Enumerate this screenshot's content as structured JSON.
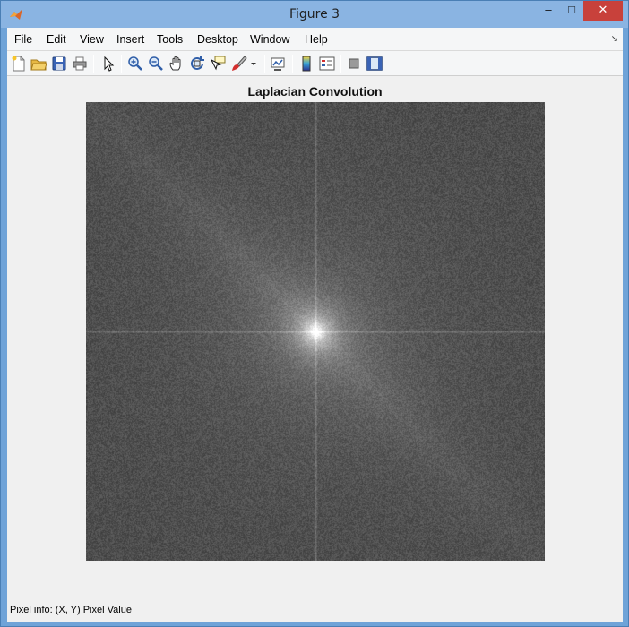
{
  "window": {
    "title": "Figure 3",
    "minimize_glyph": "–",
    "maximize_glyph": "□",
    "close_glyph": "✕"
  },
  "menu": {
    "items": [
      {
        "label": "File",
        "key": "file"
      },
      {
        "label": "Edit",
        "key": "edit"
      },
      {
        "label": "View",
        "key": "view"
      },
      {
        "label": "Insert",
        "key": "insert"
      },
      {
        "label": "Tools",
        "key": "tools"
      },
      {
        "label": "Desktop",
        "key": "desktop"
      },
      {
        "label": "Window",
        "key": "window"
      },
      {
        "label": "Help",
        "key": "help"
      }
    ],
    "dock_arrow": "↘"
  },
  "toolbar": {
    "buttons": [
      {
        "icon": "new-figure-icon"
      },
      {
        "icon": "open-file-icon"
      },
      {
        "icon": "save-icon"
      },
      {
        "icon": "print-icon"
      },
      {
        "icon": "edit-plot-arrow-icon"
      },
      {
        "icon": "zoom-in-icon"
      },
      {
        "icon": "zoom-out-icon"
      },
      {
        "icon": "pan-hand-icon"
      },
      {
        "icon": "rotate-3d-icon"
      },
      {
        "icon": "data-cursor-icon"
      },
      {
        "icon": "brush-icon"
      },
      {
        "icon": "brush-dropdown-icon"
      },
      {
        "icon": "link-plot-icon"
      },
      {
        "icon": "insert-colorbar-icon"
      },
      {
        "icon": "insert-legend-icon"
      },
      {
        "icon": "hide-plot-tools-icon"
      },
      {
        "icon": "show-plot-tools-icon"
      }
    ]
  },
  "figure": {
    "title": "Laplacian Convolution",
    "image_description_colors": {
      "background_gray": "#4a4a4a",
      "center_bright": "#e0e0e0"
    }
  },
  "status": {
    "pixel_info": "Pixel info: (X, Y)  Pixel Value"
  },
  "colors": {
    "titlebar": "#8ab4e2",
    "close_button": "#c8413b",
    "client_bg": "#f0f0f0"
  }
}
